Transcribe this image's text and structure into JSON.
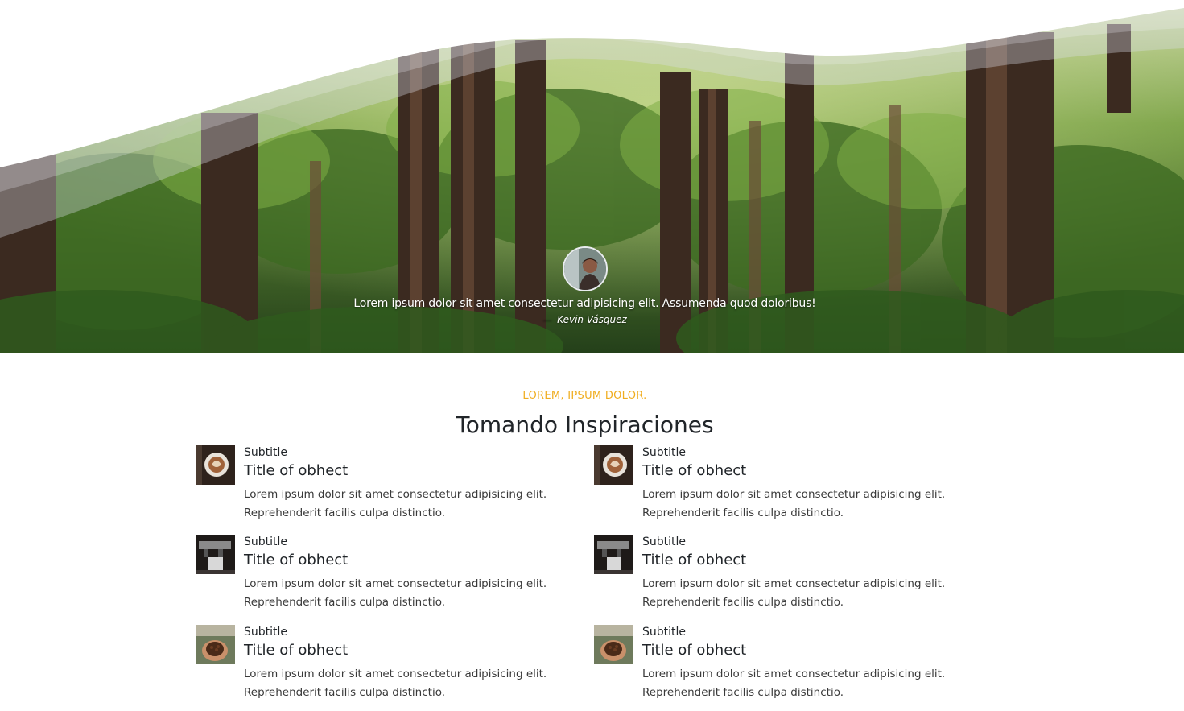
{
  "testimonial": {
    "quote": "Lorem ipsum dolor sit amet consectetur adipisicing elit. Assumenda quod doloribus!",
    "dash": "—",
    "author": "Kevin Vásquez"
  },
  "section": {
    "eyebrow": "LOREM, IPSUM DOLOR.",
    "title": "Tomando Inspiraciones",
    "items": [
      {
        "thumb_icon": "latte-art-photo",
        "subtitle": "Subtitle",
        "title": "Title of obhect",
        "text_line1": "Lorem ipsum dolor sit amet consectetur adipisicing elit.",
        "text_line2": "Reprehenderit facilis culpa distinctio."
      },
      {
        "thumb_icon": "latte-art-photo",
        "subtitle": "Subtitle",
        "title": "Title of obhect",
        "text_line1": "Lorem ipsum dolor sit amet consectetur adipisicing elit.",
        "text_line2": "Reprehenderit facilis culpa distinctio."
      },
      {
        "thumb_icon": "espresso-machine-photo",
        "subtitle": "Subtitle",
        "title": "Title of obhect",
        "text_line1": "Lorem ipsum dolor sit amet consectetur adipisicing elit.",
        "text_line2": "Reprehenderit facilis culpa distinctio."
      },
      {
        "thumb_icon": "espresso-machine-photo",
        "subtitle": "Subtitle",
        "title": "Title of obhect",
        "text_line1": "Lorem ipsum dolor sit amet consectetur adipisicing elit.",
        "text_line2": "Reprehenderit facilis culpa distinctio."
      },
      {
        "thumb_icon": "coffee-beans-hands-photo",
        "subtitle": "Subtitle",
        "title": "Title of obhect",
        "text_line1": "Lorem ipsum dolor sit amet consectetur adipisicing elit.",
        "text_line2": "Reprehenderit facilis culpa distinctio."
      },
      {
        "thumb_icon": "coffee-beans-hands-photo",
        "subtitle": "Subtitle",
        "title": "Title of obhect",
        "text_line1": "Lorem ipsum dolor sit amet consectetur adipisicing elit.",
        "text_line2": "Reprehenderit facilis culpa distinctio."
      }
    ]
  },
  "colors": {
    "accent": "#f0ad1f",
    "heading": "#212529",
    "wave": "#ffffff"
  }
}
